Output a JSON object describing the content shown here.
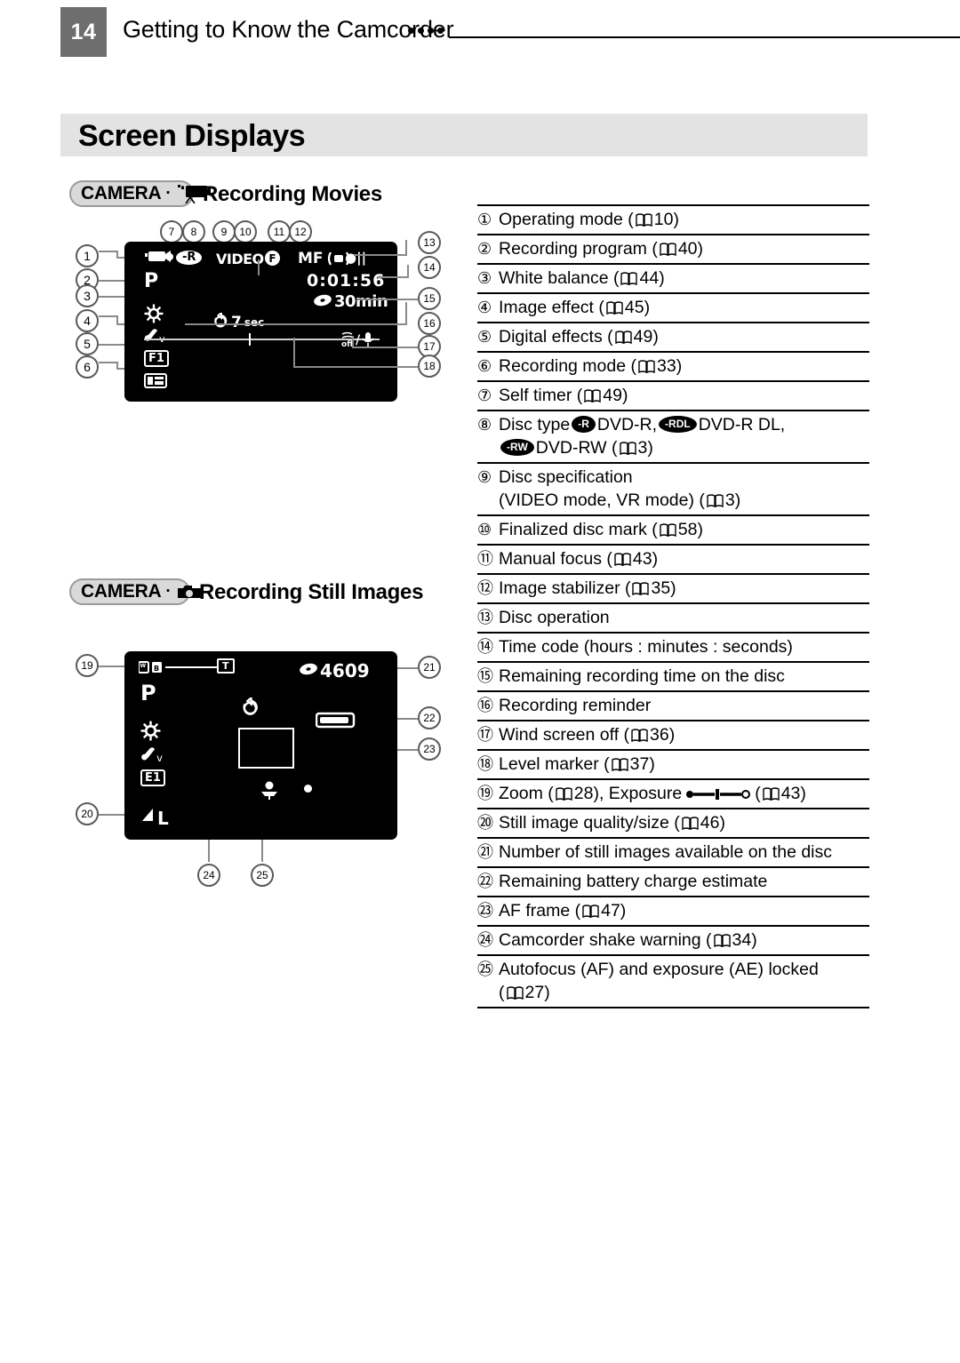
{
  "header": {
    "page_number": "14",
    "title": "Getting to Know the Camcorder",
    "dots": 4
  },
  "section": {
    "title": "Screen Displays"
  },
  "subsections": [
    {
      "badge_label": "CAMERA",
      "badge_separator": "·",
      "badge_icon": "movie-camera-icon",
      "heading": "Recording Movies"
    },
    {
      "badge_label": "CAMERA",
      "badge_separator": "·",
      "badge_icon": "still-camera-icon",
      "heading": "Recording Still Images"
    }
  ],
  "screen_movies": {
    "operating_mode": "movie-camera-icon",
    "recording_program": "P",
    "white_balance": "daylight-icon",
    "image_effect": "image-effect-v-icon",
    "digital_effects": "F1",
    "recording_mode": "recording-mode-icon",
    "disc_type": "-R",
    "disc_spec": "VIDEO",
    "finalized_mark": "F",
    "manual_focus": "MF",
    "image_stabilizer": "stabilizer-icon",
    "disc_operation": "●||",
    "time_code": "0:01:56",
    "remaining_time": "30min",
    "remaining_time_icon": "disc-icon",
    "self_timer": "7",
    "self_timer_unit": "sec",
    "self_timer_icon": "self-timer-icon",
    "wind_screen_off": "WS-off-mic-icon",
    "level_marker": "level-marker-line"
  },
  "screen_stills": {
    "zoom_label": "zoom-bar",
    "zoom_tele": "T",
    "recording_program": "P",
    "white_balance": "daylight-icon",
    "image_effect": "image-effect-v-icon",
    "digital_effects": "E1",
    "still_quality": "L",
    "still_quality_icon": "quality-fine-icon",
    "still_count": "4609",
    "still_count_icon": "disc-icon",
    "battery": "battery-icon",
    "af_frame": "af-frame",
    "self_timer_icon": "self-timer-icon",
    "shake_warning": "camcorder-shake-icon",
    "ae_af_lock": "ae-af-lock-dot"
  },
  "legend": [
    {
      "num": "①",
      "text": "Operating mode (",
      "page": "10",
      "tail": ")"
    },
    {
      "num": "②",
      "text": "Recording program (",
      "page": "40",
      "tail": ")"
    },
    {
      "num": "③",
      "text": "White balance (",
      "page": "44",
      "tail": ")"
    },
    {
      "num": "④",
      "text": "Image effect (",
      "page": "45",
      "tail": ")"
    },
    {
      "num": "⑤",
      "text": "Digital effects (",
      "page": "49",
      "tail": ")"
    },
    {
      "num": "⑥",
      "text": "Recording mode (",
      "page": "33",
      "tail": ")"
    },
    {
      "num": "⑦",
      "text": "Self timer (",
      "page": "49",
      "tail": ")"
    },
    {
      "num": "⑧",
      "text": "Disc type",
      "disc_types": [
        {
          "tag": "-R",
          "label": "DVD-R,"
        },
        {
          "tag": "-RDL",
          "label": "DVD-R DL,"
        }
      ],
      "second_line_tag": "-RW",
      "second_line_label": "DVD-RW (",
      "page": "3",
      "tail": ")"
    },
    {
      "num": "⑨",
      "text": "Disc specification",
      "sub": "(VIDEO mode, VR mode) (",
      "page": "3",
      "tail": ")"
    },
    {
      "num": "⑩",
      "text": "Finalized disc mark (",
      "page": "58",
      "tail": ")"
    },
    {
      "num": "⑪",
      "text": "Manual focus (",
      "page": "43",
      "tail": ")"
    },
    {
      "num": "⑫",
      "text": "Image stabilizer (",
      "page": "35",
      "tail": ")"
    },
    {
      "num": "⑬",
      "text": "Disc operation"
    },
    {
      "num": "⑭",
      "text": "Time code (hours : minutes : seconds)"
    },
    {
      "num": "⑮",
      "text": "Remaining recording time on the disc"
    },
    {
      "num": "⑯",
      "text": "Recording reminder"
    },
    {
      "num": "⑰",
      "text": "Wind screen off (",
      "page": "36",
      "tail": ")"
    },
    {
      "num": "⑱",
      "text": "Level marker (",
      "page": "37",
      "tail": ")"
    },
    {
      "num": "⑲",
      "text": "Zoom (",
      "page": "28",
      "tail": "), Exposure",
      "expo": true,
      "page2": "43"
    },
    {
      "num": "⑳",
      "text": "Still image quality/size (",
      "page": "46",
      "tail": ")"
    },
    {
      "num": "㉑",
      "text": "Number of still images available on the disc"
    },
    {
      "num": "㉒",
      "text": "Remaining battery charge estimate"
    },
    {
      "num": "㉓",
      "text": "AF frame (",
      "page": "47",
      "tail": ")"
    },
    {
      "num": "㉔",
      "text": "Camcorder shake warning (",
      "page": "34",
      "tail": ")"
    },
    {
      "num": "㉕",
      "text": "Autofocus (AF) and exposure (AE) locked",
      "sub2": "(",
      "page": "27",
      "tail": ")"
    }
  ],
  "callouts_movies": [
    "1",
    "2",
    "3",
    "4",
    "5",
    "6",
    "7",
    "8",
    "9",
    "10",
    "11",
    "12",
    "13",
    "14",
    "15",
    "16",
    "17",
    "18"
  ],
  "callouts_stills": [
    "19",
    "20",
    "21",
    "22",
    "23",
    "24",
    "25"
  ],
  "colors": {
    "page_number_bg": "#6e6e6e",
    "banner_bg": "#e3e3e3",
    "badge_bg": "#d9d9d9",
    "lcd_bg": "#000000",
    "leader": "#8a8a8a"
  }
}
